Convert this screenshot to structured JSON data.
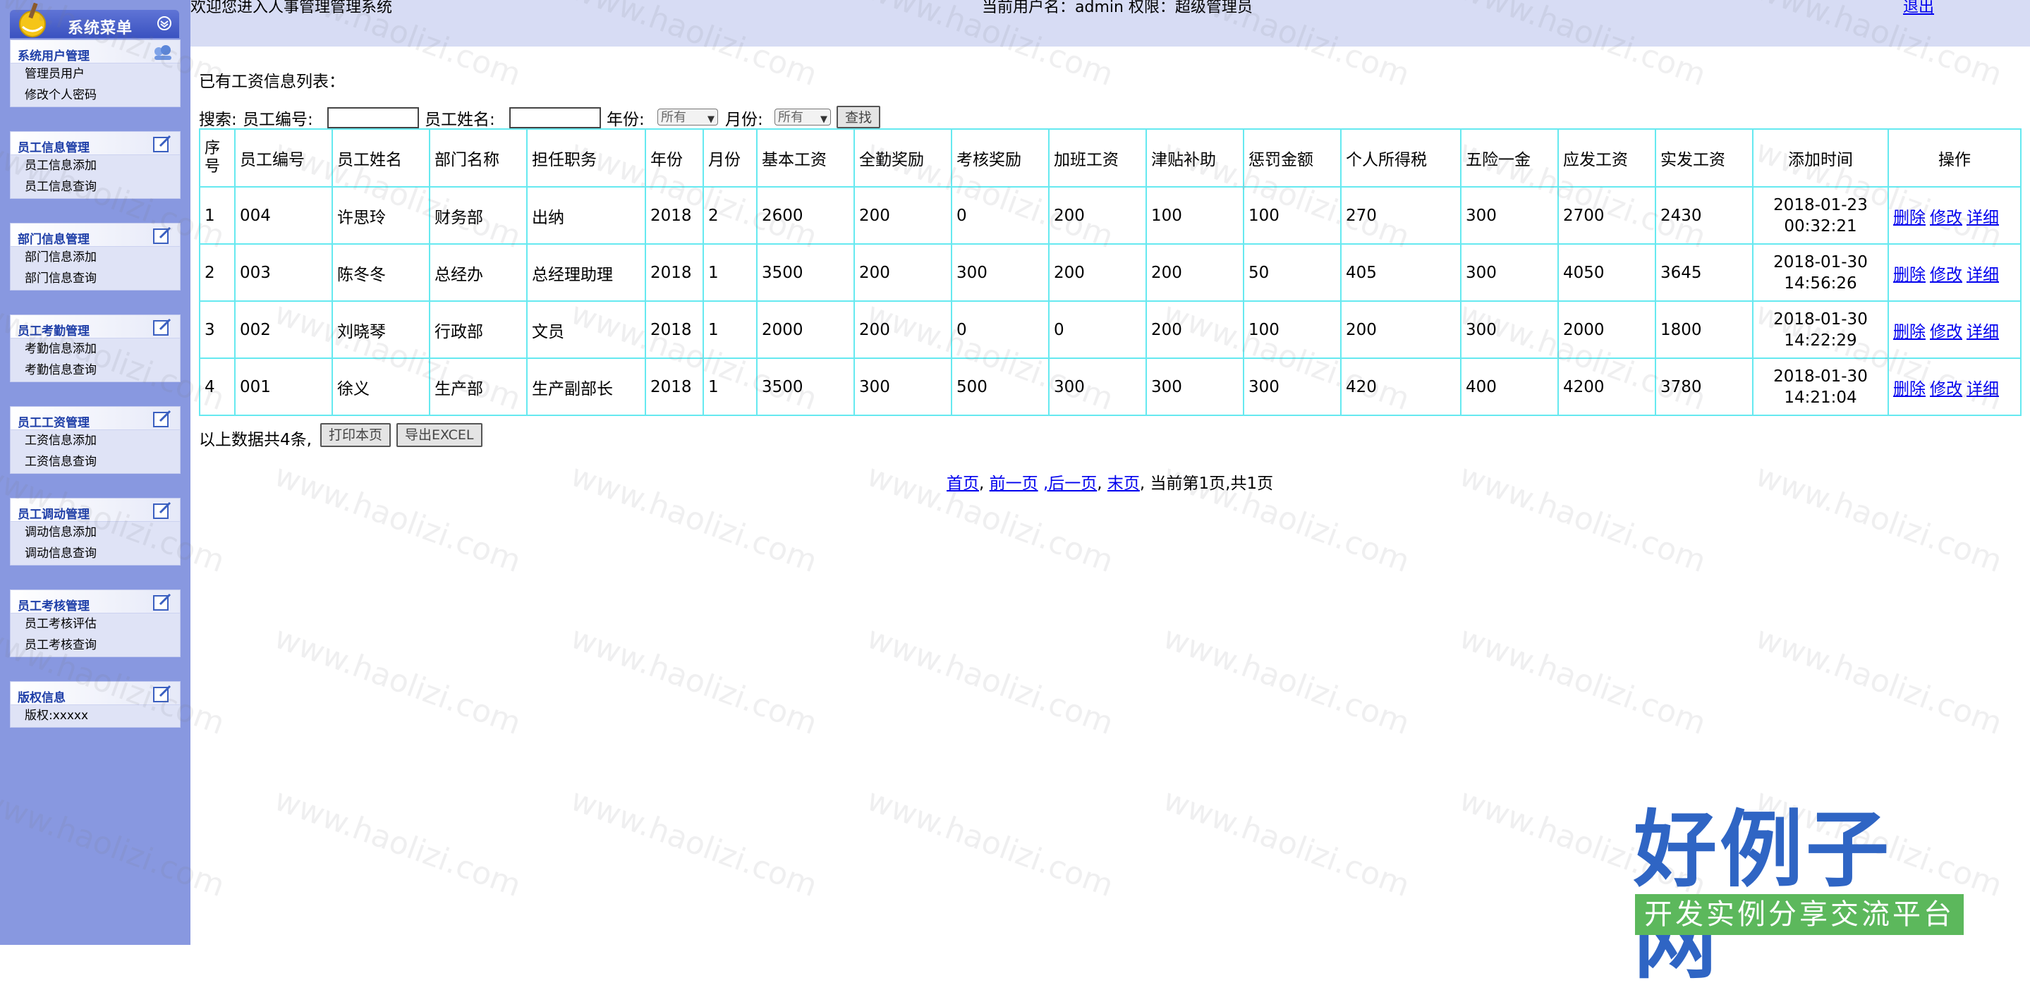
{
  "sidebar": {
    "header_title": "系统菜单",
    "panels": [
      {
        "title": "系统用户管理",
        "items": [
          "管理员用户",
          "修改个人密码"
        ]
      },
      {
        "title": "员工信息管理",
        "items": [
          "员工信息添加",
          "员工信息查询"
        ]
      },
      {
        "title": "部门信息管理",
        "items": [
          "部门信息添加",
          "部门信息查询"
        ]
      },
      {
        "title": "员工考勤管理",
        "items": [
          "考勤信息添加",
          "考勤信息查询"
        ]
      },
      {
        "title": "员工工资管理",
        "items": [
          "工资信息添加",
          "工资信息查询"
        ]
      },
      {
        "title": "员工调动管理",
        "items": [
          "调动信息添加",
          "调动信息查询"
        ]
      },
      {
        "title": "员工考核管理",
        "items": [
          "员工考核评估",
          "员工考核查询"
        ]
      },
      {
        "title": "版权信息",
        "items": [
          "版权:xxxxx"
        ]
      }
    ]
  },
  "topbar": {
    "welcome": "欢迎您进入人事管理管理系统",
    "user_info": "当前用户名：admin 权限：超级管理员",
    "logout": "退出"
  },
  "main": {
    "list_title": "已有工资信息列表：",
    "search": {
      "label": "搜索:",
      "emp_no_label": "员工编号:",
      "emp_name_label": "员工姓名:",
      "year_label": "年份:",
      "year_value": "所有",
      "month_label": "月份:",
      "month_value": "所有",
      "search_button": "查找"
    },
    "table": {
      "headers": [
        "序号",
        "员工编号",
        "员工姓名",
        "部门名称",
        "担任职务",
        "年份",
        "月份",
        "基本工资",
        "全勤奖励",
        "考核奖励",
        "加班工资",
        "津贴补助",
        "惩罚金额",
        "个人所得税",
        "五险一金",
        "应发工资",
        "实发工资",
        "添加时间",
        "操作"
      ],
      "rows": [
        [
          "1",
          "004",
          "许思玲",
          "财务部",
          "出纳",
          "2018",
          "2",
          "2600",
          "200",
          "0",
          "200",
          "100",
          "100",
          "270",
          "300",
          "2700",
          "2430",
          "2018-01-23",
          "00:32:21"
        ],
        [
          "2",
          "003",
          "陈冬冬",
          "总经办",
          "总经理助理",
          "2018",
          "1",
          "3500",
          "200",
          "300",
          "200",
          "200",
          "50",
          "405",
          "300",
          "4050",
          "3645",
          "2018-01-30",
          "14:56:26"
        ],
        [
          "3",
          "002",
          "刘晓琴",
          "行政部",
          "文员",
          "2018",
          "1",
          "2000",
          "200",
          "0",
          "0",
          "200",
          "100",
          "200",
          "300",
          "2000",
          "1800",
          "2018-01-30",
          "14:22:29"
        ],
        [
          "4",
          "001",
          "徐义",
          "生产部",
          "生产副部长",
          "2018",
          "1",
          "3500",
          "300",
          "500",
          "300",
          "300",
          "300",
          "420",
          "400",
          "4200",
          "3780",
          "2018-01-30",
          "14:21:04"
        ]
      ],
      "op_delete": "删除",
      "op_edit": "修改",
      "op_detail": "详细"
    },
    "footer": {
      "count_text": "以上数据共4条,",
      "print_button": "打印本页",
      "export_button": "导出EXCEL"
    },
    "pager": {
      "first": "首页",
      "prev": "前一页",
      "next": ",后一页",
      "last": "末页",
      "status": ", 当前第1页,共1页",
      "sep1": ", ",
      "sep2": " ",
      "sep3": ", "
    }
  },
  "watermark": {
    "text": "www.haolizi.com",
    "logo_big": "好例子网",
    "logo_small": "开发实例分享交流平台"
  },
  "colors": {
    "sidebar_bg": "#8898e0",
    "topbar_bg": "#d7dcf4",
    "table_border": "#66e9f0",
    "panel_title": "#1f3fa8",
    "link": "#0000ee"
  }
}
